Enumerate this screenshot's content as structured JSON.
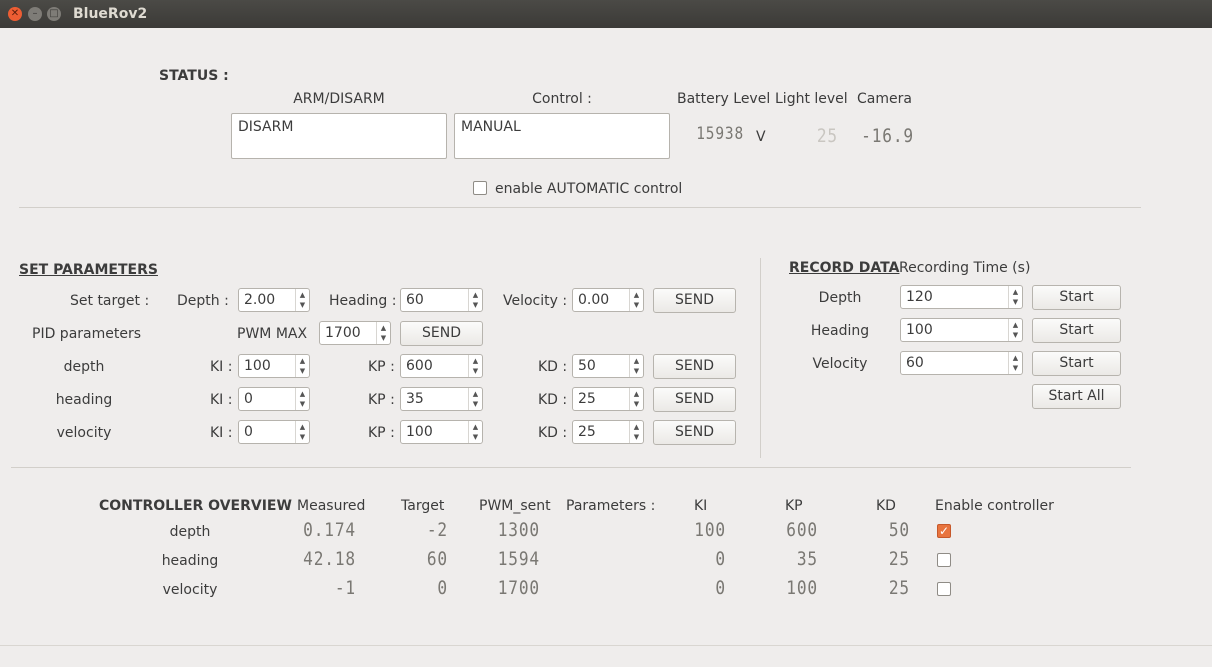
{
  "window": {
    "title": "BlueRov2"
  },
  "status": {
    "heading": "STATUS :",
    "arm_label": "ARM/DISARM",
    "arm_value": "DISARM",
    "control_label": "Control :",
    "control_value": "MANUAL",
    "battery_label": "Battery Level",
    "battery_value": "15938",
    "battery_unit": "V",
    "light_label": "Light level",
    "light_value": "25",
    "camera_label": "Camera",
    "camera_value": "-16.9",
    "automatic_label": "enable AUTOMATIC control",
    "automatic_checked": false
  },
  "params": {
    "heading": "SET PARAMETERS",
    "set_target": "Set target :",
    "depth_label": "Depth :",
    "depth_value": "2.00",
    "heading_label": "Heading :",
    "heading_value": "60",
    "velocity_label": "Velocity :",
    "velocity_value": "0.00",
    "send": "SEND",
    "pid_label": "PID parameters",
    "pwm_label": "PWM MAX",
    "pwm_value": "1700",
    "ki_label": "KI :",
    "kp_label": "KP :",
    "kd_label": "KD :",
    "rows": [
      {
        "name": "depth",
        "ki": "100",
        "kp": "600",
        "kd": "50"
      },
      {
        "name": "heading",
        "ki": "0",
        "kp": "35",
        "kd": "25"
      },
      {
        "name": "velocity",
        "ki": "0",
        "kp": "100",
        "kd": "25"
      }
    ]
  },
  "record": {
    "heading": "RECORD DATA",
    "time_label": "Recording Time (s)",
    "start": "Start",
    "start_all": "Start All",
    "rows": [
      {
        "name": "Depth",
        "value": "120"
      },
      {
        "name": "Heading",
        "value": "100"
      },
      {
        "name": "Velocity",
        "value": "60"
      }
    ]
  },
  "overview": {
    "heading": "CONTROLLER OVERVIEW",
    "col_measured": "Measured",
    "col_target": "Target",
    "col_pwm": "PWM_sent",
    "col_params": "Parameters :",
    "col_ki": "KI",
    "col_kp": "KP",
    "col_kd": "KD",
    "col_enable": "Enable controller",
    "rows": [
      {
        "name": "depth",
        "measured": "0.174",
        "target": "-2",
        "pwm": "1300",
        "ki": "100",
        "kp": "600",
        "kd": "50",
        "enabled": true
      },
      {
        "name": "heading",
        "measured": "42.18",
        "target": "60",
        "pwm": "1594",
        "ki": "0",
        "kp": "35",
        "kd": "25",
        "enabled": false
      },
      {
        "name": "velocity",
        "measured": "-1",
        "target": "0",
        "pwm": "1700",
        "ki": "0",
        "kp": "100",
        "kd": "25",
        "enabled": false
      }
    ]
  },
  "colors": {
    "accent": "#e8743e",
    "titlebar": "#3b3a37",
    "background": "#efedec"
  }
}
